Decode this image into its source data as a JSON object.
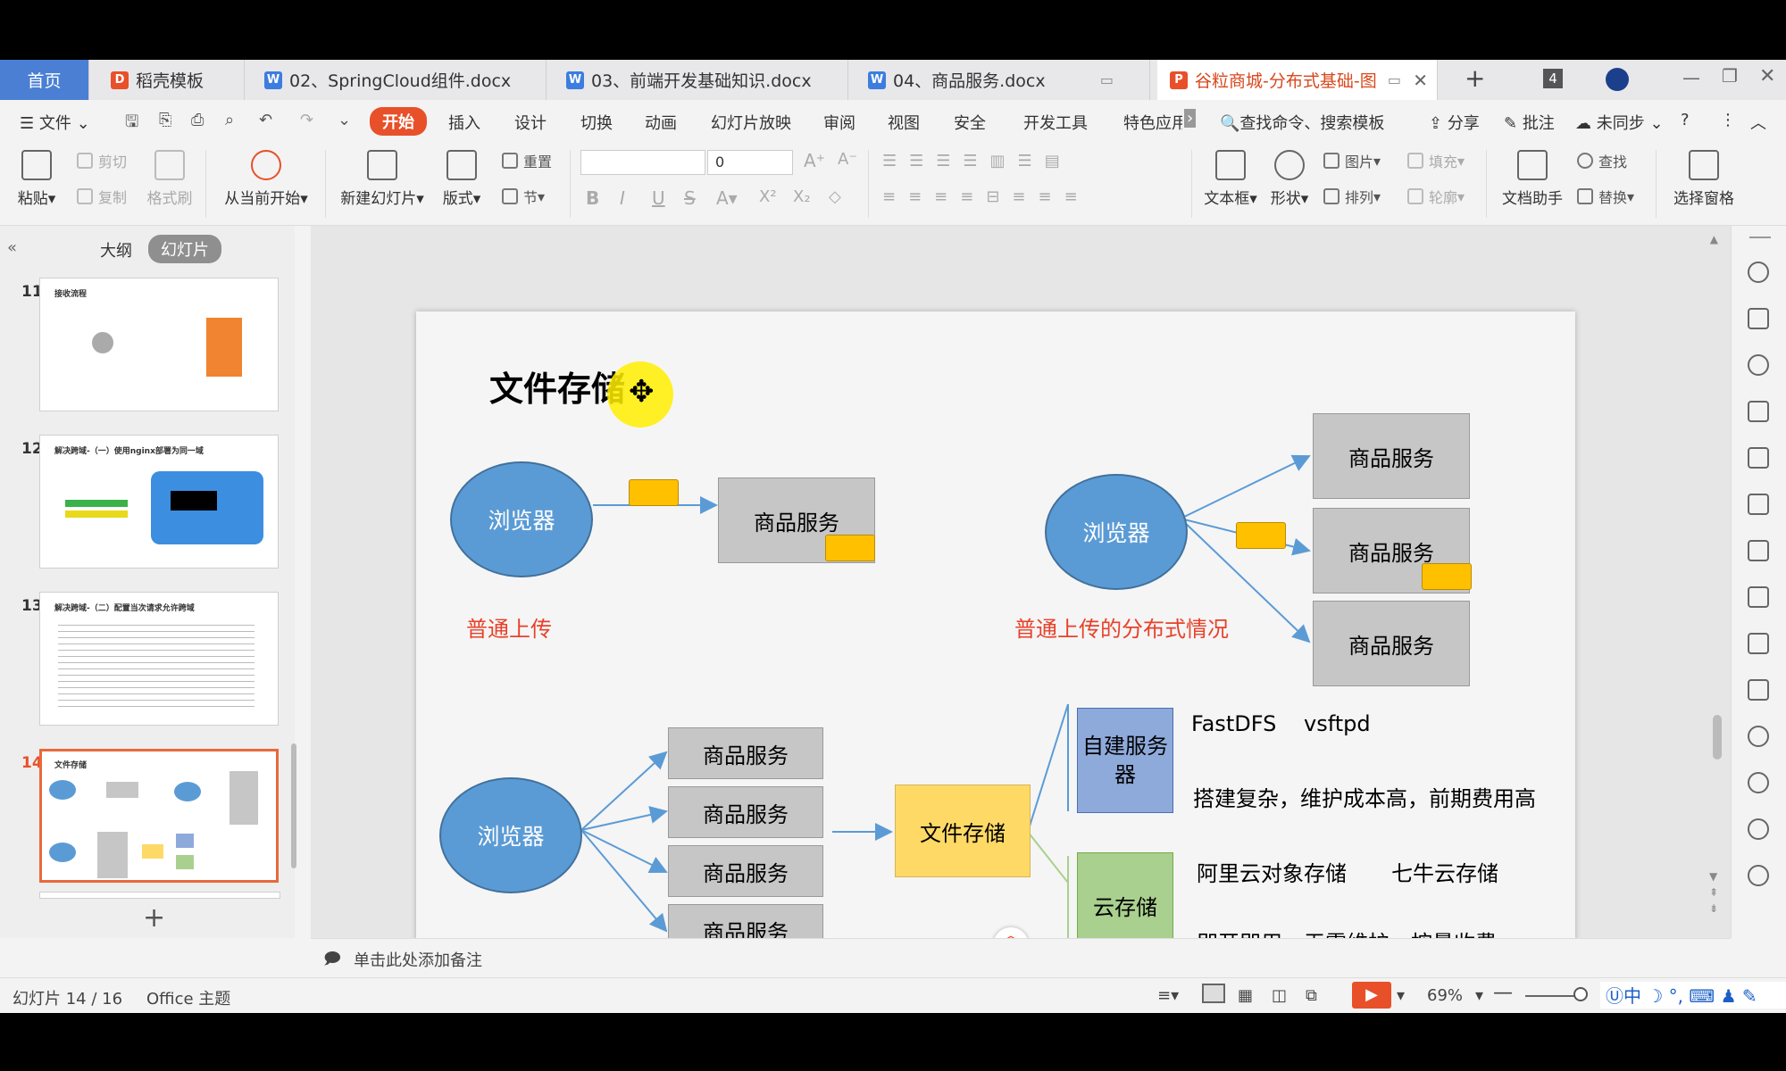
{
  "tabs": [
    {
      "label": "首页"
    },
    {
      "label": "稻壳模板"
    },
    {
      "label": "02、SpringCloud组件.docx"
    },
    {
      "label": "03、前端开发基础知识.docx"
    },
    {
      "label": "04、商品服务.docx"
    },
    {
      "label": "谷粒商城-分布式基础-图"
    }
  ],
  "tab_count": "4",
  "menu": {
    "file": "文件",
    "items": [
      "开始",
      "插入",
      "设计",
      "切换",
      "动画",
      "幻灯片放映",
      "审阅",
      "视图",
      "安全",
      "开发工具",
      "特色应用"
    ],
    "search": "查找命令、搜索模板",
    "share": "分享",
    "comment": "批注",
    "sync": "未同步"
  },
  "toolbar": {
    "paste": "粘贴",
    "cut": "剪切",
    "copy": "复制",
    "format_painter": "格式刷",
    "play_from_current": "从当前开始",
    "new_slide": "新建幻灯片",
    "layout": "版式",
    "reset": "重置",
    "section": "节",
    "font_size": "0",
    "textbox": "文本框",
    "shape": "形状",
    "picture": "图片",
    "fill": "填充",
    "arrange": "排列",
    "outline": "轮廓",
    "doc_assistant": "文档助手",
    "find": "查找",
    "replace": "替换",
    "select_pane": "选择窗格"
  },
  "panel_tabs": {
    "outline": "大纲",
    "slides": "幻灯片"
  },
  "thumbnails": [
    {
      "num": "11",
      "title": "接收流程"
    },
    {
      "num": "12",
      "title": "解决跨域-（一）使用nginx部署为同一域"
    },
    {
      "num": "13",
      "title": "解决跨域-（二）配置当次请求允许跨域"
    },
    {
      "num": "14",
      "title": "文件存储"
    }
  ],
  "slide": {
    "title": "文件存储",
    "browser": "浏览器",
    "service": "商品服务",
    "normal_upload": "普通上传",
    "distributed_upload": "普通上传的分布式情况",
    "file_storage": "文件存储",
    "self_server": "自建服务器",
    "cloud": "云存储",
    "self_options_1": "FastDFS",
    "self_options_2": "vsftpd",
    "self_desc": "搭建复杂，维护成本高，前期费用高",
    "cloud_options_1": "阿里云对象存储",
    "cloud_options_2": "七牛云存储",
    "cloud_desc": "即开即用，无需维护，按量收费"
  },
  "notes_placeholder": "单击此处添加备注",
  "status": {
    "slide_pos": "幻灯片 14 / 16",
    "theme": "Office 主题",
    "zoom": "69%"
  },
  "colors": {
    "accent": "#e8502a",
    "oval": "#5b9bd5",
    "file_box": "#ffd966",
    "self_box": "#8eaadb",
    "cloud_box": "#a9d08e"
  }
}
